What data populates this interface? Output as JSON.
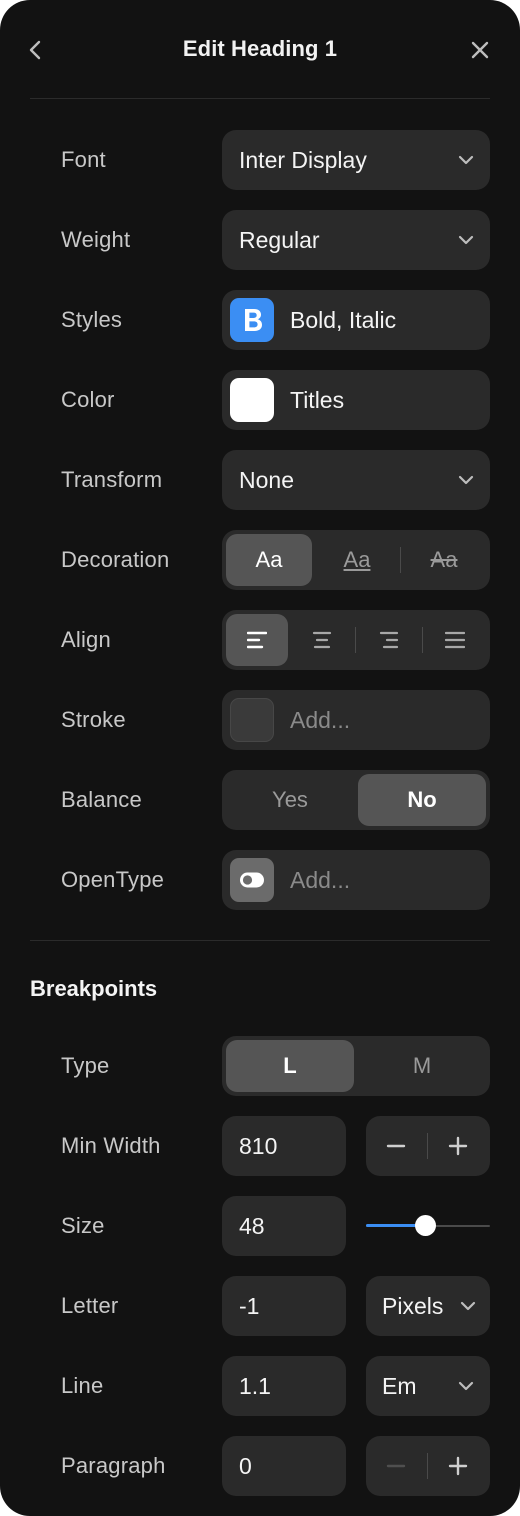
{
  "header": {
    "title": "Edit Heading 1"
  },
  "font": {
    "label": "Font",
    "value": "Inter Display"
  },
  "weight": {
    "label": "Weight",
    "value": "Regular"
  },
  "styles": {
    "label": "Styles",
    "value": "Bold, Italic",
    "swatch_color": "#3b8ef3"
  },
  "color": {
    "label": "Color",
    "value": "Titles",
    "swatch_color": "#ffffff"
  },
  "transform": {
    "label": "Transform",
    "value": "None"
  },
  "decoration": {
    "label": "Decoration",
    "options": [
      "Aa",
      "Aa",
      "Aa"
    ],
    "selected": 0
  },
  "align": {
    "label": "Align",
    "selected": "left"
  },
  "stroke": {
    "label": "Stroke",
    "placeholder": "Add..."
  },
  "balance": {
    "label": "Balance",
    "options": [
      "Yes",
      "No"
    ],
    "selected": "No"
  },
  "opentype": {
    "label": "OpenType",
    "placeholder": "Add..."
  },
  "breakpoints": {
    "title": "Breakpoints",
    "type": {
      "label": "Type",
      "options": [
        "L",
        "M"
      ],
      "selected": "L"
    },
    "min_width": {
      "label": "Min Width",
      "value": "810"
    },
    "size": {
      "label": "Size",
      "value": "48",
      "slider_fraction": 0.48
    },
    "letter": {
      "label": "Letter",
      "value": "-1",
      "unit": "Pixels"
    },
    "line": {
      "label": "Line",
      "value": "1.1",
      "unit": "Em"
    },
    "paragraph": {
      "label": "Paragraph",
      "value": "0"
    }
  },
  "colors": {
    "panel": "#121212",
    "field": "#2a2a2a",
    "active_segment": "#555555",
    "accent": "#3b8ef3"
  }
}
